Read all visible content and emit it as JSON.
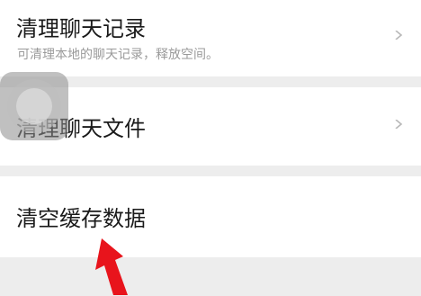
{
  "settings": {
    "items": [
      {
        "label": "清理聊天记录",
        "description": "可清理本地的聊天记录，释放空间。",
        "icon": "chevron-right-icon"
      },
      {
        "label": "清理聊天文件",
        "icon": "chevron-right-icon"
      },
      {
        "label": "清空缓存数据"
      }
    ]
  },
  "colors": {
    "background": "#ededed",
    "row": "#ffffff",
    "text": "#1a1a1a",
    "subtext": "#9a9a9a",
    "annotation_arrow": "#e8141c"
  }
}
